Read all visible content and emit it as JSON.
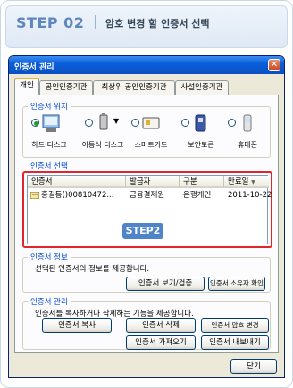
{
  "step": {
    "number": "STEP 02",
    "title": "암호 변경 할 인증서 선택"
  },
  "dialog": {
    "title": "인증서 관리",
    "close_symbol": "✕",
    "tabs": [
      "개인",
      "공인인증기관",
      "최상위 공인인증기관",
      "사설인증기관"
    ],
    "location": {
      "label": "인증서 위치",
      "devices": [
        {
          "label": "하드 디스크",
          "icon": "hard-disk-icon",
          "selected": true
        },
        {
          "label": "이동식 디스크",
          "icon": "removable-disk-icon",
          "selected": false
        },
        {
          "label": "스마트카드",
          "icon": "smartcard-icon",
          "selected": false
        },
        {
          "label": "보안토큰",
          "icon": "security-token-icon",
          "selected": false
        },
        {
          "label": "휴대폰",
          "icon": "mobile-phone-icon",
          "selected": false
        }
      ]
    },
    "selection": {
      "label": "인증서 선택",
      "columns": [
        "인증서",
        "발급자",
        "구분",
        "만료일"
      ],
      "rows": [
        {
          "cert": "홍길동()00810472...",
          "issuer": "금융결제원",
          "type": "은행개인",
          "expires": "2011-10-22"
        }
      ],
      "badge": "STEP2",
      "highlight_color": "#e0262b"
    },
    "info": {
      "label": "인증서 정보",
      "description": "선택된 인증서의 정보를 제공합니다.",
      "buttons": [
        "인증서 보기/검증",
        "인증서 소유자 확인"
      ]
    },
    "manage": {
      "label": "인증서 관리",
      "description": "인증서를 복사하거나 삭제하는 기능을 제공합니다.",
      "buttons_row1": [
        "인증서 복사",
        "인증서 삭제",
        "인증서 암호 변경"
      ],
      "buttons_row2": [
        "인증서 가져오기",
        "인증서 내보내기"
      ]
    },
    "close_button": "닫기"
  }
}
